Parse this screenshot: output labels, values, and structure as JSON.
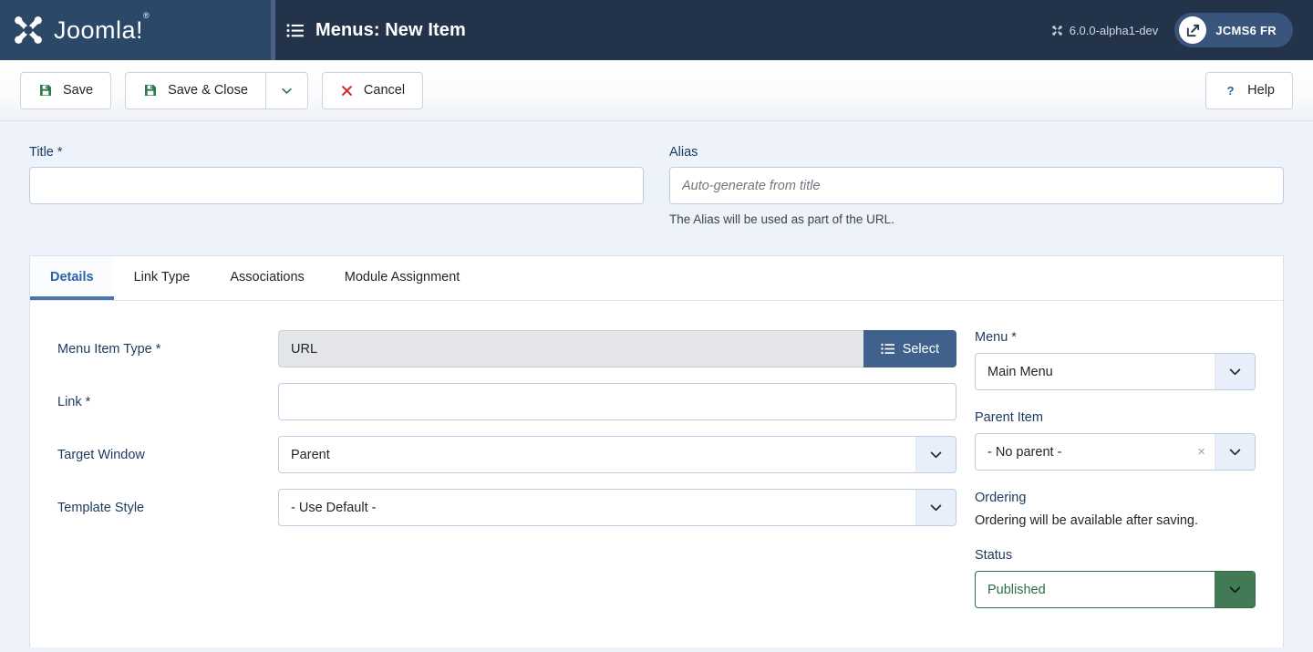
{
  "header": {
    "brand_name": "Joomla!",
    "brand_trademark": "®",
    "page_title": "Menus: New Item",
    "page_title_icon": "list-icon",
    "version": "6.0.0-alpha1-dev",
    "version_icon": "joomla-mark-icon",
    "user_label": "JCMS6 FR",
    "user_icon": "external-link-icon",
    "colors": {
      "header_bg": "#22334a",
      "brand_bg": "#2c4868",
      "accent_bar": "#47618a",
      "user_pill_bg": "#39557b"
    }
  },
  "toolbar": {
    "save_label": "Save",
    "save_icon": "save-disk-icon",
    "save_close_label": "Save & Close",
    "save_close_icon": "save-disk-icon",
    "dropdown_icon": "chevron-down-icon",
    "cancel_label": "Cancel",
    "cancel_icon": "close-x-icon",
    "help_label": "Help",
    "help_icon": "question-mark-icon",
    "colors": {
      "save_icon": "#2f7a4d",
      "cancel_icon": "#d9232d",
      "help_icon": "#2a62a8"
    }
  },
  "form": {
    "title": {
      "label": "Title *",
      "value": "",
      "placeholder": ""
    },
    "alias": {
      "label": "Alias",
      "value": "",
      "placeholder": "Auto-generate from title",
      "help": "The Alias will be used as part of the URL."
    }
  },
  "tabs": [
    {
      "label": "Details",
      "active": true
    },
    {
      "label": "Link Type",
      "active": false
    },
    {
      "label": "Associations",
      "active": false
    },
    {
      "label": "Module Assignment",
      "active": false
    }
  ],
  "details": {
    "menu_item_type": {
      "label": "Menu Item Type *",
      "value": "URL",
      "select_button_label": "Select",
      "select_button_icon": "list-icon"
    },
    "link": {
      "label": "Link *",
      "value": "",
      "placeholder": ""
    },
    "target_window": {
      "label": "Target Window",
      "value": "Parent",
      "arrow_icon": "chevron-down-icon"
    },
    "template_style": {
      "label": "Template Style",
      "value": "- Use Default -",
      "arrow_icon": "chevron-down-icon"
    }
  },
  "sidebar": {
    "menu": {
      "label": "Menu *",
      "value": "Main Menu",
      "arrow_icon": "chevron-down-icon"
    },
    "parent_item": {
      "label": "Parent Item",
      "value": "- No parent -",
      "clear_icon": "×",
      "arrow_icon": "chevron-down-icon"
    },
    "ordering": {
      "label": "Ordering",
      "note": "Ordering will be available after saving."
    },
    "status": {
      "label": "Status",
      "value": "Published",
      "arrow_icon": "chevron-down-icon",
      "accent_color": "#417a55"
    }
  }
}
